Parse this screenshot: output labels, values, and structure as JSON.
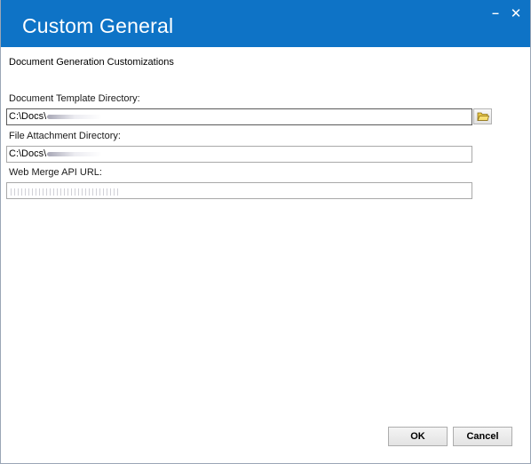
{
  "window": {
    "title": "Custom General",
    "minimize_glyph": "–",
    "close_glyph": "✕",
    "accent_color": "#0e73c6"
  },
  "section": {
    "heading": "Document Generation Customizations"
  },
  "fields": {
    "template_dir": {
      "label": "Document Template Directory:",
      "value": "C:\\Docs\\"
    },
    "attachment_dir": {
      "label": "File Attachment Directory:",
      "value": "C:\\Docs\\"
    },
    "web_merge_url": {
      "label": "Web Merge API URL:",
      "value": ""
    }
  },
  "icons": {
    "browse": "open-folder-icon"
  },
  "buttons": {
    "ok": "OK",
    "cancel": "Cancel"
  }
}
